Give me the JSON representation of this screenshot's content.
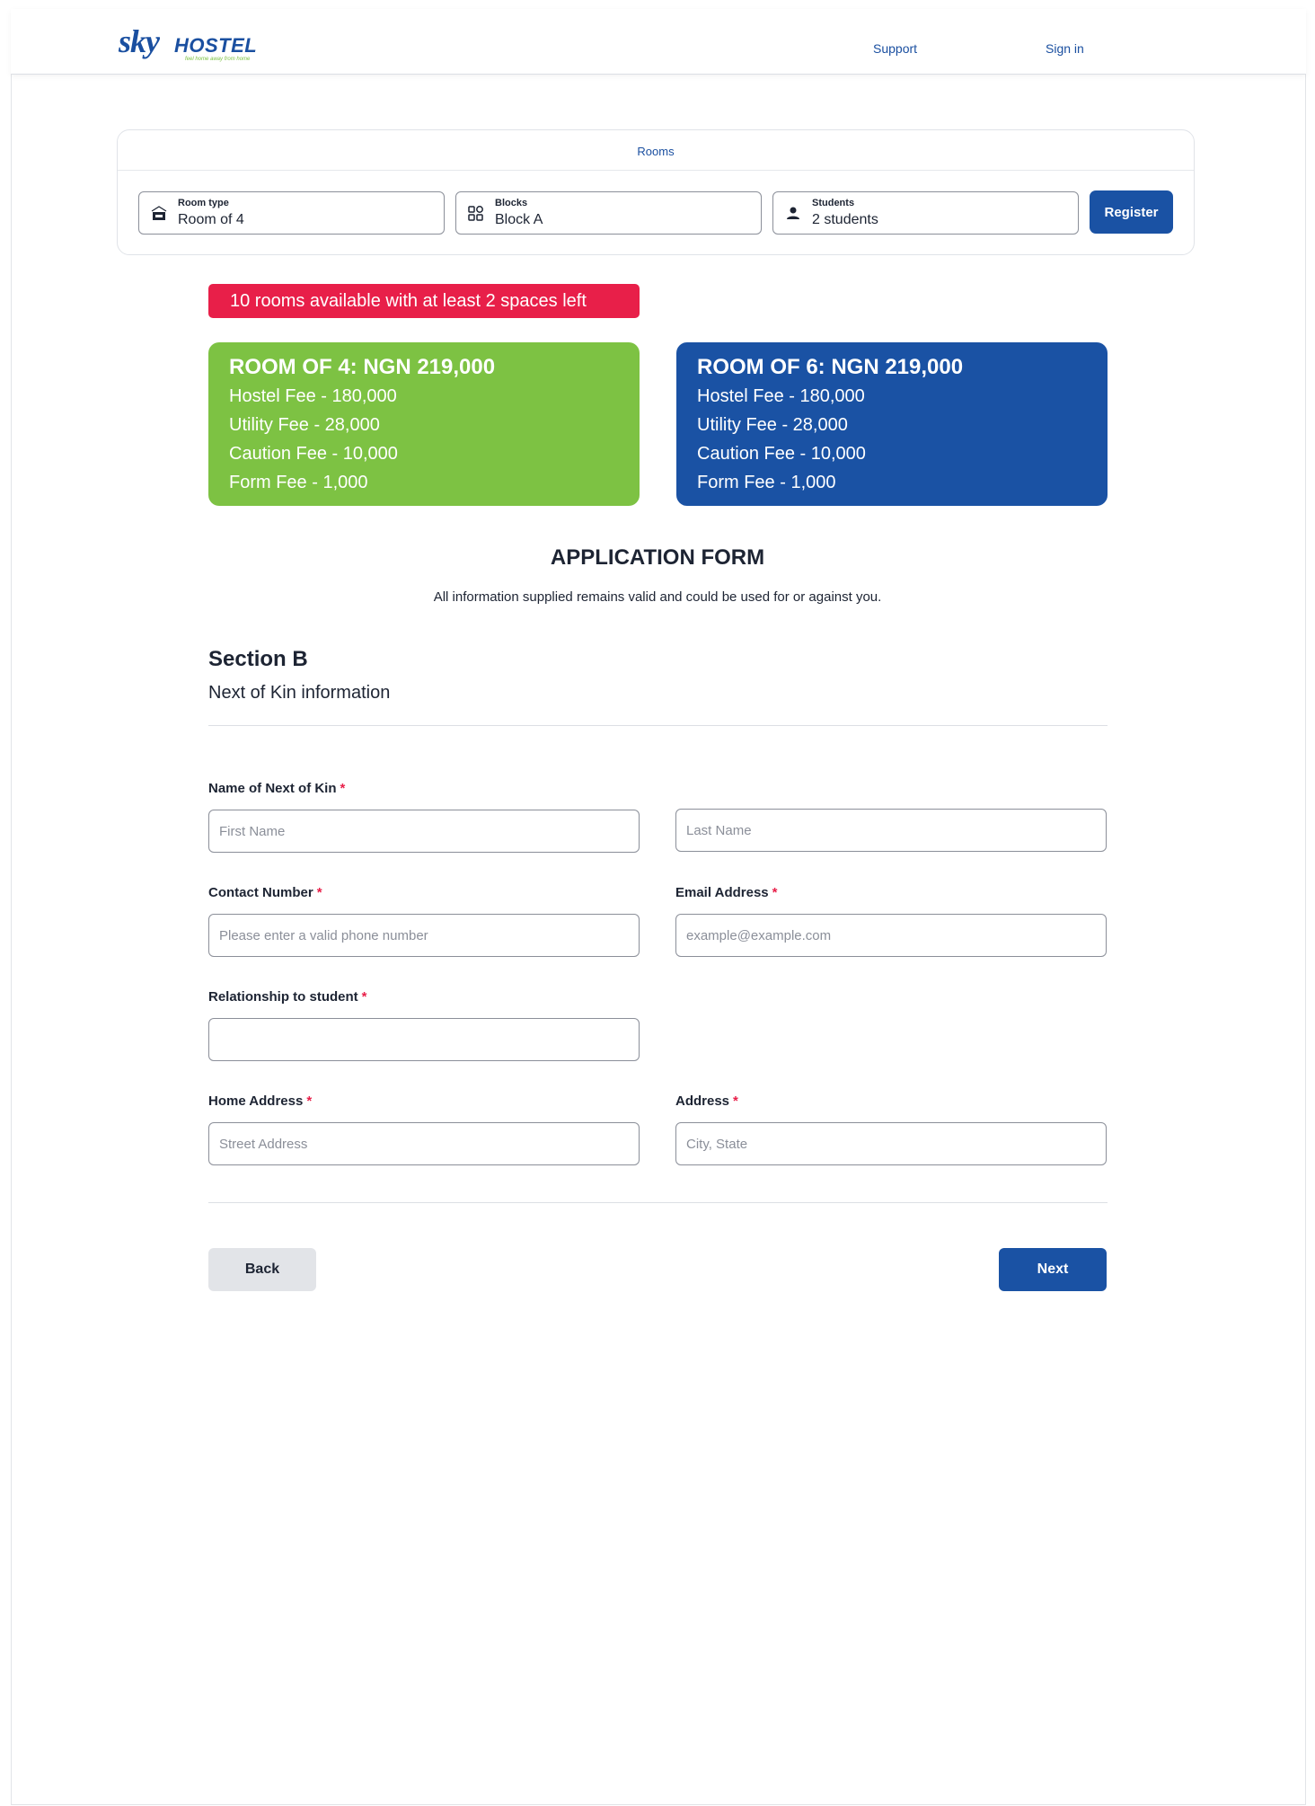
{
  "brand": {
    "logo_sky": "sky",
    "logo_hostel": "HOSTEL",
    "tagline": "feel home away from home",
    "primary_color": "#1a52a4",
    "accent_green": "#7dc243",
    "alert_red": "#e81f49"
  },
  "nav": {
    "support": "Support",
    "sign_in": "Sign in"
  },
  "rooms_search": {
    "title": "Rooms",
    "room_type": {
      "label": "Room type",
      "value": "Room of 4",
      "icon": "room-door-icon"
    },
    "blocks": {
      "label": "Blocks",
      "value": "Block A",
      "icon": "blocks-icon"
    },
    "students": {
      "label": "Students",
      "value": "2 students",
      "icon": "person-icon"
    },
    "register_label": "Register"
  },
  "availability": "10 rooms available with at least 2 spaces left",
  "room_cards": [
    {
      "title": "ROOM OF 4: NGN 219,000",
      "hostel_fee": "Hostel Fee - 180,000",
      "utility_fee": "Utility Fee - 28,000",
      "caution_fee": "Caution Fee - 10,000",
      "form_fee": "Form Fee - 1,000"
    },
    {
      "title": "ROOM OF 6: NGN 219,000",
      "hostel_fee": "Hostel Fee - 180,000",
      "utility_fee": "Utility Fee - 28,000",
      "caution_fee": "Caution Fee - 10,000",
      "form_fee": "Form Fee - 1,000"
    }
  ],
  "form": {
    "title": "APPLICATION FORM",
    "subtitle": "All information supplied remains valid and could be used for or against you.",
    "section_title": "Section B",
    "section_subtitle": "Next of Kin information",
    "required_mark": "*",
    "fields": {
      "kin_name": {
        "label": "Name of Next of Kin",
        "first_placeholder": "First Name",
        "last_placeholder": "Last Name"
      },
      "contact": {
        "label": "Contact Number",
        "placeholder": "Please enter a valid phone number"
      },
      "email": {
        "label": "Email Address",
        "placeholder": "example@example.com"
      },
      "relationship": {
        "label": "Relationship to student",
        "placeholder": ""
      },
      "home_address": {
        "label": "Home Address",
        "placeholder": "Street Address"
      },
      "address": {
        "label": "Address",
        "placeholder": "City, State"
      }
    },
    "back_label": "Back",
    "next_label": "Next"
  }
}
